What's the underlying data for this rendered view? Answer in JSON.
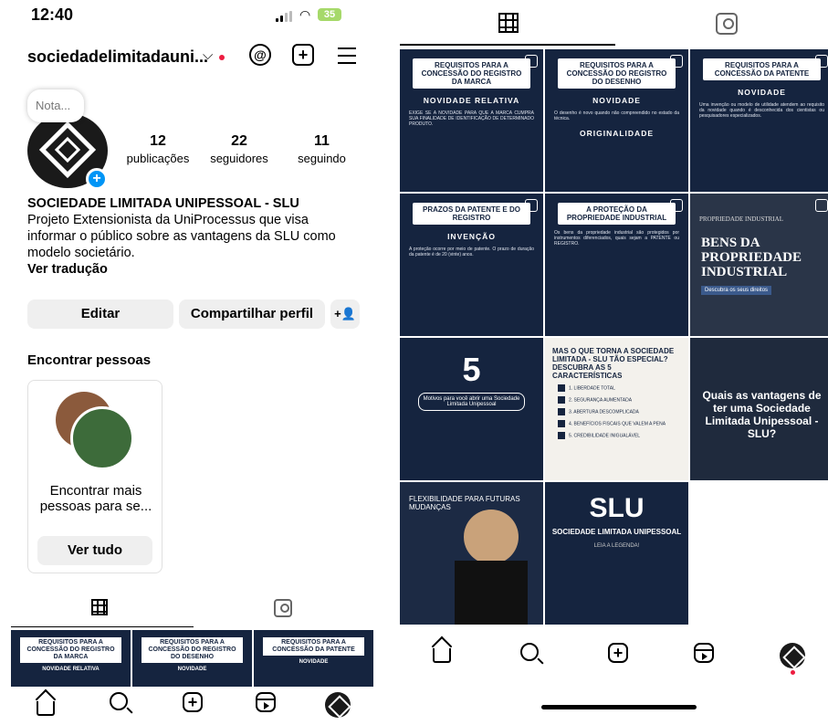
{
  "left": {
    "status": {
      "time": "12:40",
      "battery": "35"
    },
    "header": {
      "username": "sociedadelimitadauni..."
    },
    "note": "Nota...",
    "stats": [
      {
        "number": "12",
        "label": "publicações"
      },
      {
        "number": "22",
        "label": "seguidores"
      },
      {
        "number": "11",
        "label": "seguindo"
      }
    ],
    "bio": {
      "name": "SOCIEDADE LIMITADA UNIPESSOAL - SLU",
      "text": "Projeto Extensionista da UniProcessus que visa informar o público sobre as vantagens da SLU como modelo societário.",
      "translate": "Ver tradução"
    },
    "buttons": {
      "edit": "Editar",
      "share": "Compartilhar perfil",
      "add_user": "+👤"
    },
    "find_people": {
      "title": "Encontrar pessoas",
      "card_text": "Encontrar mais pessoas para se...",
      "see_all": "Ver tudo"
    },
    "thumbs": [
      {
        "header": "REQUISITOS PARA A CONCESSÃO DO REGISTRO DA MARCA",
        "sub": "NOVIDADE RELATIVA"
      },
      {
        "header": "REQUISITOS PARA A CONCESSÃO DO REGISTRO DO DESENHO",
        "sub": "NOVIDADE"
      },
      {
        "header": "REQUISITOS PARA A CONCESSÃO DA PATENTE",
        "sub": "NOVIDADE"
      }
    ]
  },
  "right": {
    "posts": [
      {
        "header": "REQUISITOS PARA A CONCESSÃO DO REGISTRO DA MARCA",
        "title": "NOVIDADE RELATIVA",
        "body": "EXIGE SE A NOVIDADE PARA QUE A MARCA CUMPRA SUA FINALIDADE DE IDENTIFICAÇÃO DE DETERMINADO PRODUTO."
      },
      {
        "header": "REQUISITOS PARA A CONCESSÃO DO REGISTRO DO DESENHO",
        "title": "NOVIDADE",
        "title2": "ORIGINALIDADE",
        "body": "O desenho é novo quando não compreendido no estado da técnica."
      },
      {
        "header": "REQUISITOS PARA A CONCESSÃO DA PATENTE",
        "title": "NOVIDADE",
        "body": "Uma invenção ou modelo de utilidade atendem ao requisito da novidade quando é desconhecida dos cientistas ou pesquisadores especializados."
      },
      {
        "header": "PRAZOS DA PATENTE E DO REGISTRO",
        "title": "INVENÇÃO",
        "body": "A proteção ocorre por meio de patente. O prazo de duração da patente é de 20 (vinte) anos."
      },
      {
        "header": "A PROTEÇÃO DA PROPRIEDADE INDUSTRIAL",
        "body": "Os bens da propriedade industrial são protegidos por instrumentos diferenciados, quais sejam a PATENTE ou REGISTRO."
      },
      {
        "top": "PROPRIEDADE INDUSTRIAL",
        "big": "BENS DA PROPRIEDADE INDUSTRIAL",
        "caption": "Descubra os seus direitos"
      },
      {
        "five": "5",
        "caption": "Motivos para você abrir uma Sociedade Limitada Unipessoal"
      },
      {
        "header": "MAS O QUE TORNA A SOCIEDADE LIMITADA - SLU TÃO ESPECIAL? DESCUBRA AS 5 CARACTERÍSTICAS",
        "items": [
          "1. LIBERDADE TOTAL",
          "2. SEGURANÇA AUMENTADA",
          "3. ABERTURA DESCOMPLICADA",
          "4. BENEFÍCIOS FISCAIS QUE VALEM A PENA",
          "5. CREDIBILIDADE INIGUALÁVEL"
        ]
      },
      {
        "title": "Quais as vantagens de ter uma Sociedade Limitada Unipessoal - SLU?"
      },
      {
        "title": "FLEXIBILIDADE PARA FUTURAS MUDANÇAS"
      },
      {
        "title": "SLU",
        "sub": "SOCIEDADE LIMITADA UNIPESSOAL",
        "caption": "LEIA A LEGENDA!"
      }
    ]
  }
}
